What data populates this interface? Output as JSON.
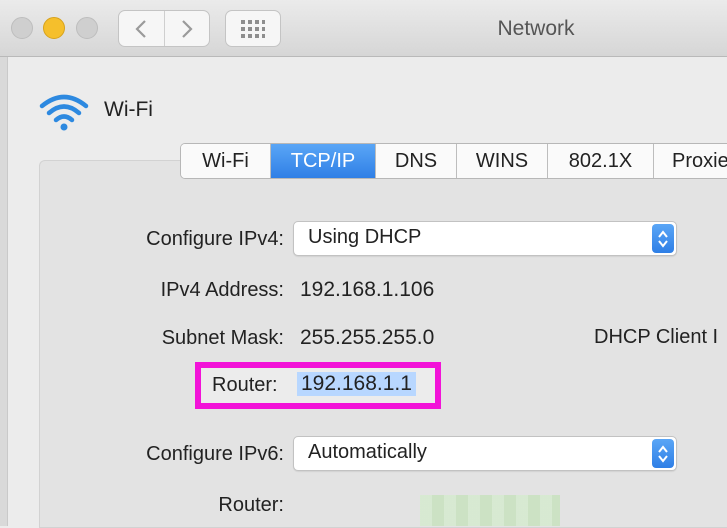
{
  "window": {
    "title": "Network"
  },
  "service": {
    "name": "Wi-Fi"
  },
  "tabs": [
    {
      "label": "Wi-Fi",
      "active": false
    },
    {
      "label": "TCP/IP",
      "active": true
    },
    {
      "label": "DNS",
      "active": false
    },
    {
      "label": "WINS",
      "active": false
    },
    {
      "label": "802.1X",
      "active": false
    },
    {
      "label": "Proxie",
      "active": false
    }
  ],
  "ipv4": {
    "configure_label": "Configure IPv4:",
    "configure_value": "Using DHCP",
    "address_label": "IPv4 Address:",
    "address_value": "192.168.1.106",
    "subnet_label": "Subnet Mask:",
    "subnet_value": "255.255.255.0",
    "dhcp_client_label": "DHCP Client I",
    "router_label": "Router:",
    "router_value": "192.168.1.1"
  },
  "ipv6": {
    "configure_label": "Configure IPv6:",
    "configure_value": "Automatically",
    "router_label": "Router:"
  },
  "icons": {
    "wifi": "wifi-icon",
    "back": "chevron-left-icon",
    "forward": "chevron-right-icon",
    "grid": "grid-icon",
    "popup": "up-down-chevron-icon"
  },
  "colors": {
    "accent": "#2f7fe6",
    "highlight_border": "#f213d8",
    "selection": "#b8d7ff"
  }
}
